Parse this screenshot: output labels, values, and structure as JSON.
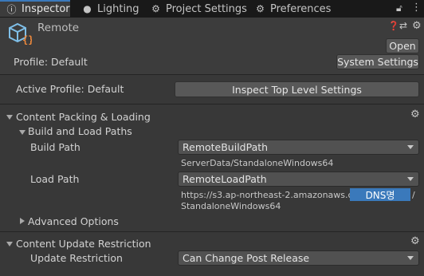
{
  "tabs": [
    {
      "label": "Inspector",
      "icon": "info-icon",
      "active": true
    },
    {
      "label": "Lighting",
      "icon": "lightbulb-icon",
      "active": false
    },
    {
      "label": "Project Settings",
      "icon": "gear-icon",
      "active": false
    },
    {
      "label": "Preferences",
      "icon": "gear-icon",
      "active": false
    }
  ],
  "header": {
    "title": "Remote",
    "open_label": "Open",
    "profile_label": "Profile: Default",
    "system_settings_label": "System Settings"
  },
  "active_profile": {
    "label": "Active Profile: Default",
    "button_label": "Inspect Top Level Settings"
  },
  "content_packing": {
    "title": "Content Packing & Loading",
    "build_load_paths_title": "Build and Load Paths",
    "build_path_label": "Build Path",
    "build_path_value": "RemoteBuildPath",
    "build_path_resolved": "ServerData/StandaloneWindows64",
    "load_path_label": "Load Path",
    "load_path_value": "RemoteLoadPath",
    "load_path_resolved_prefix": "https://s3.ap-northeast-2.amazonaws.com/",
    "load_path_highlight": "DNS명",
    "load_path_resolved_suffix": "/",
    "load_path_resolved_line2": "StandaloneWindows64",
    "advanced_options_label": "Advanced Options"
  },
  "content_update": {
    "title": "Content Update Restriction",
    "update_restriction_label": "Update Restriction",
    "update_restriction_value": "Can Change Post Release"
  },
  "colors": {
    "accent": "#3a79bb",
    "highlight": "#3a79bb"
  }
}
